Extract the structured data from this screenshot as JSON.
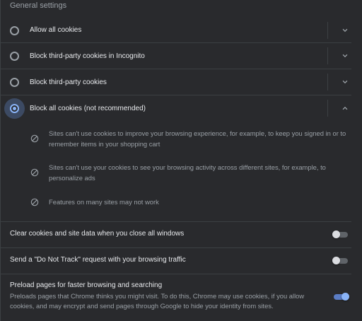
{
  "section_title": "General settings",
  "cookie_options": [
    {
      "label": "Allow all cookies",
      "selected": false,
      "expanded": false
    },
    {
      "label": "Block third-party cookies in Incognito",
      "selected": false,
      "expanded": false
    },
    {
      "label": "Block third-party cookies",
      "selected": false,
      "expanded": false
    },
    {
      "label": "Block all cookies (not recommended)",
      "selected": true,
      "expanded": true
    }
  ],
  "block_all_details": [
    "Sites can't use cookies to improve your browsing experience, for example, to keep you signed in or to remember items in your shopping cart",
    "Sites can't use your cookies to see your browsing activity across different sites, for example, to personalize ads",
    "Features on many sites may not work"
  ],
  "settings": [
    {
      "label": "Clear cookies and site data when you close all windows",
      "enabled": false
    },
    {
      "label": "Send a \"Do Not Track\" request with your browsing traffic",
      "enabled": false
    },
    {
      "label": "Preload pages for faster browsing and searching",
      "description": "Preloads pages that Chrome thinks you might visit. To do this, Chrome may use cookies, if you allow cookies, and may encrypt and send pages through Google to hide your identity from sites.",
      "enabled": true
    }
  ],
  "icons": {
    "expand": "chevron-down-icon",
    "collapse": "chevron-up-icon",
    "blocked": "block-icon"
  },
  "colors": {
    "background": "#292a2d",
    "text": "#e8eaed",
    "secondary_text": "#9aa0a6",
    "accent": "#8ab4f8",
    "divider": "#3c4043"
  }
}
